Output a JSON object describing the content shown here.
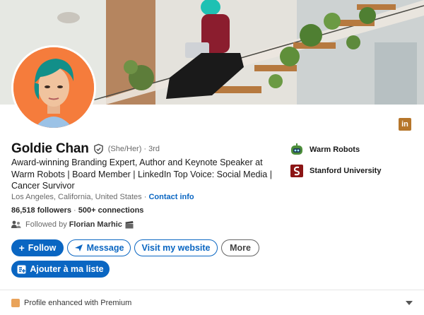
{
  "profile": {
    "name": "Goldie Chan",
    "pronouns": "(She/Her)",
    "degree": "· 3rd",
    "headline": "Award-winning Branding Expert, Author and Keynote Speaker at Warm Robots | Board Member | LinkedIn Top Voice: Social Media | Cancer Survivor",
    "location": "Los Angeles, California, United States",
    "location_separator": " · ",
    "contact_link": "Contact info",
    "followers": "86,518 followers",
    "stats_separator": " · ",
    "connections": "500+ connections",
    "followed_by_prefix": "Followed by",
    "followed_by_name": "Florian Marhic"
  },
  "actions": {
    "follow": "Follow",
    "message": "Message",
    "website": "Visit my website",
    "more": "More",
    "add_to_list": "Ajouter à ma liste"
  },
  "companies": [
    {
      "name": "Warm Robots",
      "icon": "robot-logo-icon"
    },
    {
      "name": "Stanford University",
      "icon": "stanford-logo-icon"
    }
  ],
  "premium": {
    "label": "Profile enhanced with Premium"
  },
  "colors": {
    "brand_blue": "#0a66c2",
    "avatar_bg": "#f57c3c",
    "premium_gold": "#b6762b"
  }
}
